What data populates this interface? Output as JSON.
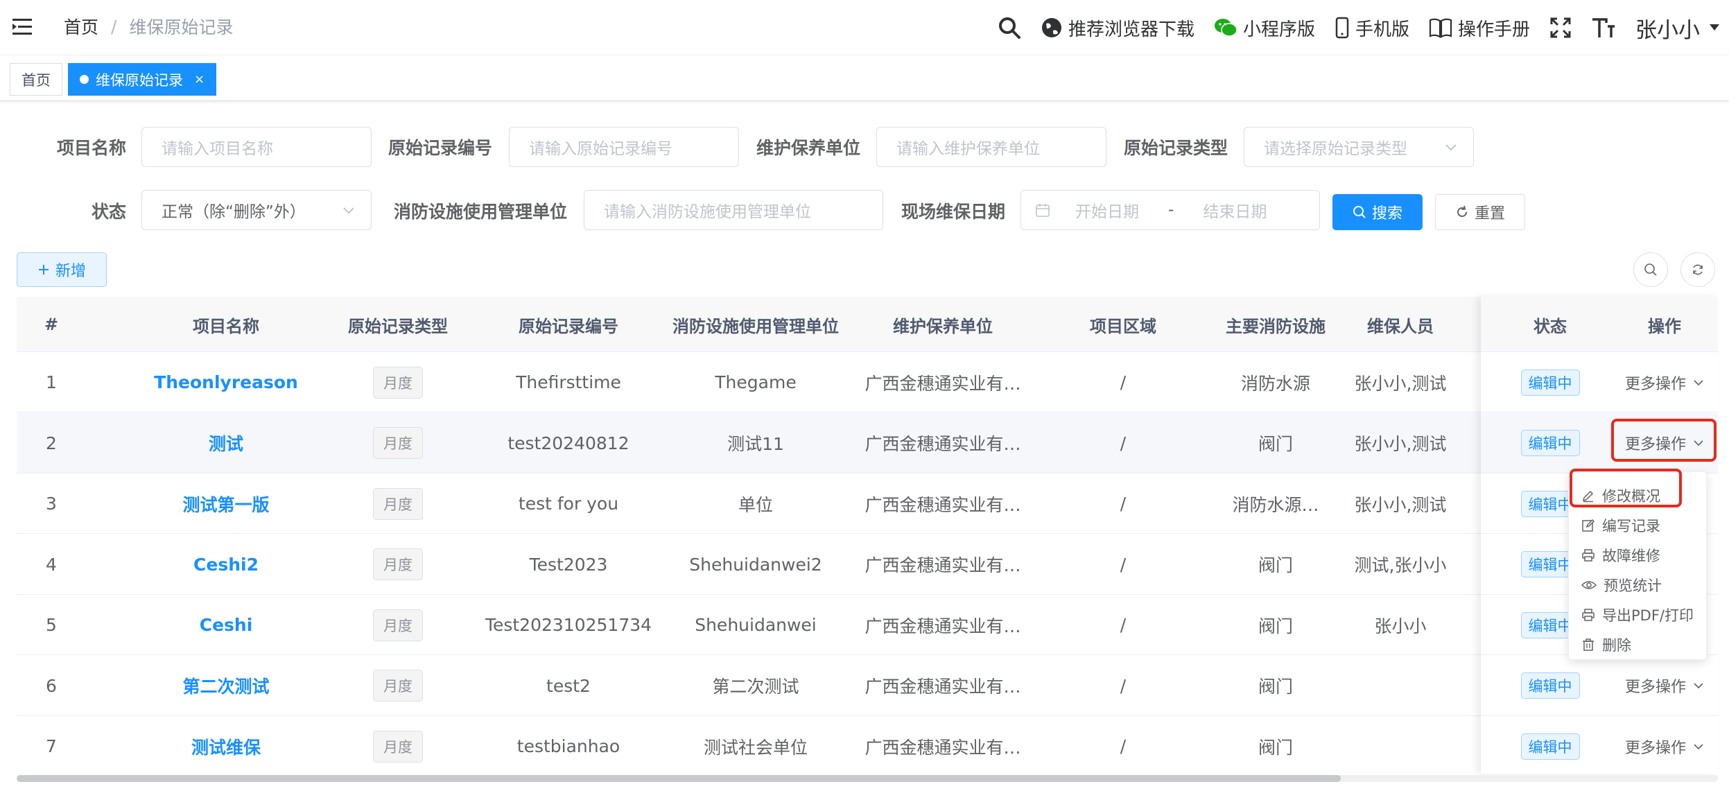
{
  "header": {
    "breadcrumb_home": "首页",
    "breadcrumb_sep": "/",
    "breadcrumb_current": "维保原始记录",
    "browser_download": "推荐浏览器下载",
    "mini_program": "小程序版",
    "mobile": "手机版",
    "manual": "操作手册",
    "user": "张小小"
  },
  "tags": {
    "home": "首页",
    "current": "维保原始记录",
    "close": "×"
  },
  "filters": {
    "project_name_label": "项目名称",
    "project_name_placeholder": "请输入项目名称",
    "record_no_label": "原始记录编号",
    "record_no_placeholder": "请输入原始记录编号",
    "maint_unit_label": "维护保养单位",
    "maint_unit_placeholder": "请输入维护保养单位",
    "record_type_label": "原始记录类型",
    "record_type_placeholder": "请选择原始记录类型",
    "status_label": "状态",
    "status_value": "正常（除“删除”外）",
    "mgmt_unit_label": "消防设施使用管理单位",
    "mgmt_unit_placeholder": "请输入消防设施使用管理单位",
    "date_label": "现场维保日期",
    "date_start": "开始日期",
    "date_sep": "-",
    "date_end": "结束日期",
    "search": "搜索",
    "reset": "重置"
  },
  "toolbar": {
    "add": "新增"
  },
  "table": {
    "headers": [
      "#",
      "项目名称",
      "原始记录类型",
      "原始记录编号",
      "消防设施使用管理单位",
      "维护保养单位",
      "项目区域",
      "主要消防设施",
      "维保人员",
      "状态",
      "操作"
    ],
    "rows": [
      {
        "no": "1",
        "name": "Theonlyreason",
        "type": "月度",
        "code": "Thefirsttime",
        "mgmt": "Thegame",
        "maint": "广西金穗通实业有…",
        "area": "/",
        "facility": "消防水源",
        "staff": "张小小,测试",
        "status": "编辑中",
        "op": "更多操作"
      },
      {
        "no": "2",
        "name": "测试",
        "type": "月度",
        "code": "test20240812",
        "mgmt": "测试11",
        "maint": "广西金穗通实业有…",
        "area": "/",
        "facility": "阀门",
        "staff": "张小小,测试",
        "status": "编辑中",
        "op": "更多操作"
      },
      {
        "no": "3",
        "name": "测试第一版",
        "type": "月度",
        "code": "test for you",
        "mgmt": "单位",
        "maint": "广西金穗通实业有…",
        "area": "/",
        "facility": "消防水源…",
        "staff": "张小小,测试",
        "status": "编辑中",
        "op": ""
      },
      {
        "no": "4",
        "name": "Ceshi2",
        "type": "月度",
        "code": "Test2023",
        "mgmt": "Shehuidanwei2",
        "maint": "广西金穗通实业有…",
        "area": "/",
        "facility": "阀门",
        "staff": "测试,张小小",
        "status": "编辑中",
        "op": ""
      },
      {
        "no": "5",
        "name": "Ceshi",
        "type": "月度",
        "code": "Test202310251734",
        "mgmt": "Shehuidanwei",
        "maint": "广西金穗通实业有…",
        "area": "/",
        "facility": "阀门",
        "staff": "张小小",
        "status": "编辑中",
        "op": ""
      },
      {
        "no": "6",
        "name": "第二次测试",
        "type": "月度",
        "code": "test2",
        "mgmt": "第二次测试",
        "maint": "广西金穗通实业有…",
        "area": "/",
        "facility": "阀门",
        "staff": "",
        "status": "编辑中",
        "op": "更多操作"
      },
      {
        "no": "7",
        "name": "测试维保",
        "type": "月度",
        "code": "testbianhao",
        "mgmt": "测试社会单位",
        "maint": "广西金穗通实业有…",
        "area": "/",
        "facility": "阀门",
        "staff": "",
        "status": "编辑中",
        "op": "更多操作"
      }
    ]
  },
  "dropdown": {
    "items": [
      "修改概况",
      "编写记录",
      "故障维修",
      "预览统计",
      "导出PDF/打印",
      "删除"
    ]
  },
  "colors": {
    "primary": "#1890ff",
    "highlight": "#e8291d"
  }
}
